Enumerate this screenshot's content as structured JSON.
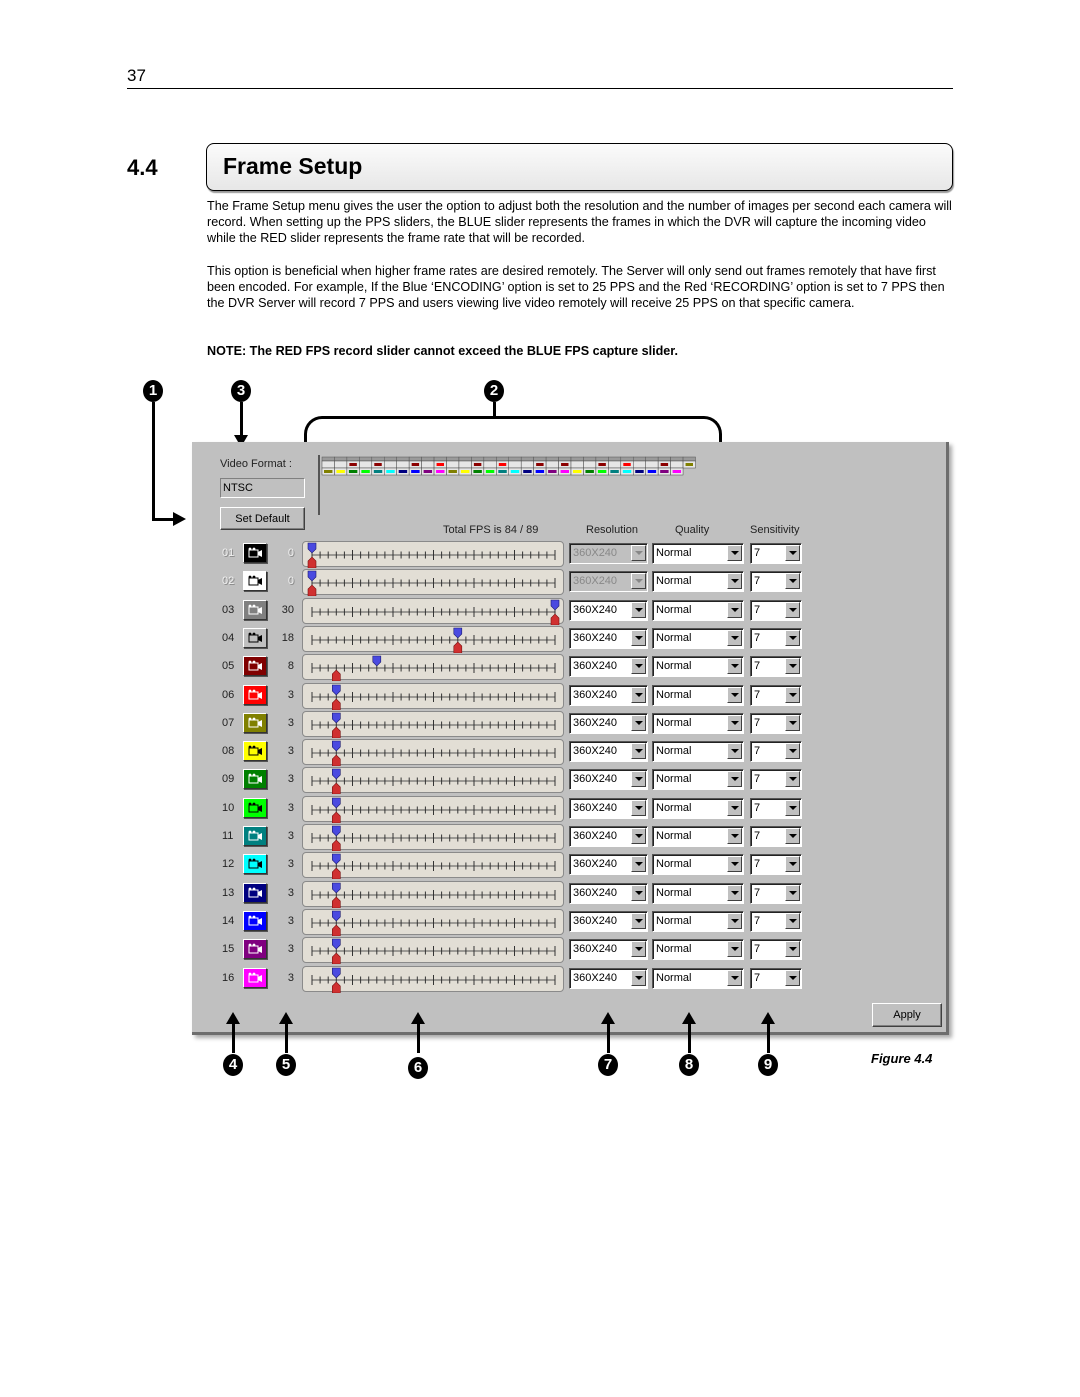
{
  "page": {
    "number": "37",
    "section_number": "4.4",
    "section_title": "Frame Setup",
    "paragraphs": [
      "The Frame Setup menu gives the user the option to adjust both the resolution and the number of images per second each camera will record. When setting up the PPS sliders, the BLUE slider represents the frames in which the DVR will capture the incoming video while the RED slider represents the frame rate that will be recorded.",
      "This option is beneficial when higher frame rates are desired remotely. The Server will only send out frames remotely that have first been encoded. For example, If the Blue ‘ENCODING’ option is set to 25 PPS and the Red ‘RECORDING’ option is set to 7 PPS then the DVR Server will record 7 PPS and users viewing live video remotely will receive 25 PPS on that specific camera."
    ],
    "note": "NOTE: The RED FPS record slider cannot exceed the BLUE FPS capture slider.",
    "figure_caption": "Figure 4.4",
    "callouts": [
      "1",
      "2",
      "3",
      "4",
      "5",
      "6",
      "7",
      "8",
      "9"
    ]
  },
  "dialog": {
    "video_format_label": "Video Format :",
    "video_format_value": "NTSC",
    "set_default_label": "Set Default",
    "total_fps_label": "Total FPS is 84 / 89",
    "col_resolution": "Resolution",
    "col_quality": "Quality",
    "col_sensitivity": "Sensitivity",
    "apply_label": "Apply",
    "slider_max": 30,
    "schedule": {
      "top_row": [
        "",
        "",
        "#8b0000",
        "",
        "#8b0000",
        "",
        "",
        "#8b0000",
        "",
        "#ff0000",
        "",
        "",
        "#8b0000",
        "",
        "#ff0000",
        "",
        "",
        "#8b0000",
        "",
        "#8b0000",
        "",
        "",
        "#8b0000",
        "",
        "#ff0000",
        "",
        "",
        "#8b0000",
        "",
        "#808000"
      ],
      "bottom_row": [
        "#808000",
        "#ffff00",
        "#008000",
        "#00ff00",
        "#008080",
        "#00ffff",
        "#000080",
        "#0000ff",
        "#800080",
        "#ff00ff",
        "#808000",
        "#ffff00",
        "#008000",
        "#00ff00",
        "#008080",
        "#00ffff",
        "#000080",
        "#0000ff",
        "#800080",
        "#ff00ff",
        "#ffff00",
        "#008000",
        "#00ff00",
        "#008080",
        "#00ffff",
        "#000080",
        "#0000ff",
        "#800080",
        "#ff00ff"
      ]
    },
    "cameras": [
      {
        "num": "01",
        "color": "#000000",
        "fps": "0",
        "capture": 0,
        "record": 0,
        "resolution": "360X240",
        "quality": "Normal",
        "sensitivity": "7",
        "enabled": false
      },
      {
        "num": "02",
        "color": "#ffffff",
        "fps": "0",
        "capture": 0,
        "record": 0,
        "resolution": "360X240",
        "quality": "Normal",
        "sensitivity": "7",
        "enabled": false
      },
      {
        "num": "03",
        "color": "#808080",
        "fps": "30",
        "capture": 30,
        "record": 30,
        "resolution": "360X240",
        "quality": "Normal",
        "sensitivity": "7",
        "enabled": true
      },
      {
        "num": "04",
        "color": "#c0c0c0",
        "fps": "18",
        "capture": 18,
        "record": 18,
        "resolution": "360X240",
        "quality": "Normal",
        "sensitivity": "7",
        "enabled": true
      },
      {
        "num": "05",
        "color": "#800000",
        "fps": "8",
        "capture": 8,
        "record": 3,
        "resolution": "360X240",
        "quality": "Normal",
        "sensitivity": "7",
        "enabled": true
      },
      {
        "num": "06",
        "color": "#ff0000",
        "fps": "3",
        "capture": 3,
        "record": 3,
        "resolution": "360X240",
        "quality": "Normal",
        "sensitivity": "7",
        "enabled": true
      },
      {
        "num": "07",
        "color": "#808000",
        "fps": "3",
        "capture": 3,
        "record": 3,
        "resolution": "360X240",
        "quality": "Normal",
        "sensitivity": "7",
        "enabled": true
      },
      {
        "num": "08",
        "color": "#ffff00",
        "fps": "3",
        "capture": 3,
        "record": 3,
        "resolution": "360X240",
        "quality": "Normal",
        "sensitivity": "7",
        "enabled": true
      },
      {
        "num": "09",
        "color": "#008000",
        "fps": "3",
        "capture": 3,
        "record": 3,
        "resolution": "360X240",
        "quality": "Normal",
        "sensitivity": "7",
        "enabled": true
      },
      {
        "num": "10",
        "color": "#00ff00",
        "fps": "3",
        "capture": 3,
        "record": 3,
        "resolution": "360X240",
        "quality": "Normal",
        "sensitivity": "7",
        "enabled": true
      },
      {
        "num": "11",
        "color": "#008080",
        "fps": "3",
        "capture": 3,
        "record": 3,
        "resolution": "360X240",
        "quality": "Normal",
        "sensitivity": "7",
        "enabled": true
      },
      {
        "num": "12",
        "color": "#00ffff",
        "fps": "3",
        "capture": 3,
        "record": 3,
        "resolution": "360X240",
        "quality": "Normal",
        "sensitivity": "7",
        "enabled": true
      },
      {
        "num": "13",
        "color": "#000080",
        "fps": "3",
        "capture": 3,
        "record": 3,
        "resolution": "360X240",
        "quality": "Normal",
        "sensitivity": "7",
        "enabled": true
      },
      {
        "num": "14",
        "color": "#0000ff",
        "fps": "3",
        "capture": 3,
        "record": 3,
        "resolution": "360X240",
        "quality": "Normal",
        "sensitivity": "7",
        "enabled": true
      },
      {
        "num": "15",
        "color": "#800080",
        "fps": "3",
        "capture": 3,
        "record": 3,
        "resolution": "360X240",
        "quality": "Normal",
        "sensitivity": "7",
        "enabled": true
      },
      {
        "num": "16",
        "color": "#ff00ff",
        "fps": "3",
        "capture": 3,
        "record": 3,
        "resolution": "360X240",
        "quality": "Normal",
        "sensitivity": "7",
        "enabled": true
      }
    ],
    "colors": {
      "capture_thumb": "#4a4ae0",
      "record_thumb": "#d03030",
      "panel_bg": "#c0c0c0",
      "slider_bg": "#e2ded5"
    }
  }
}
